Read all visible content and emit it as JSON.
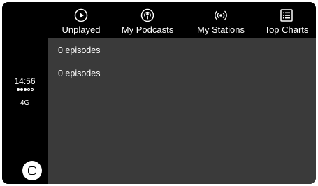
{
  "status": {
    "time": "14:56",
    "signal_bars_filled": 3,
    "signal_bars_total": 5,
    "network": "4G"
  },
  "tabs": [
    {
      "label": "Unplayed",
      "icon": "play-circle-icon"
    },
    {
      "label": "My Podcasts",
      "icon": "podcast-icon"
    },
    {
      "label": "My Stations",
      "icon": "broadcast-icon"
    },
    {
      "label": "Top Charts",
      "icon": "list-icon"
    }
  ],
  "content": {
    "rows": [
      {
        "text": "0 episodes"
      },
      {
        "text": "0 episodes"
      }
    ]
  },
  "colors": {
    "chrome": "#000000",
    "content_bg": "#3a3a3a",
    "text": "#ffffff"
  }
}
